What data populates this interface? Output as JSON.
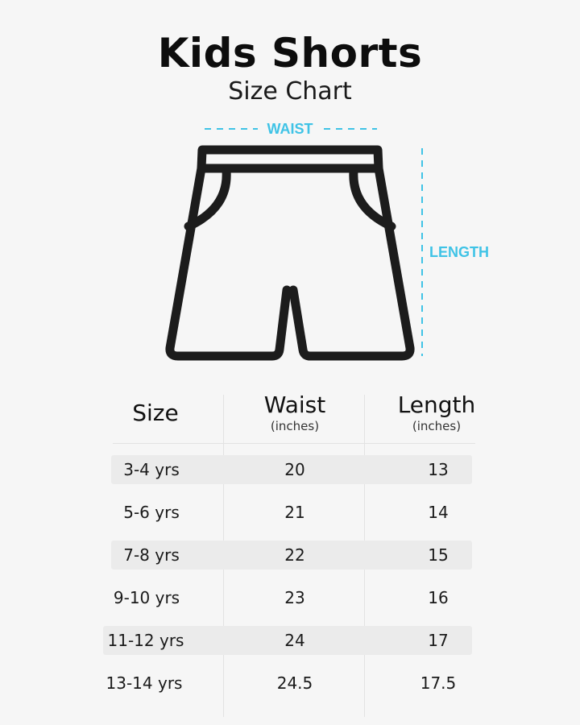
{
  "header": {
    "title": "Kids Shorts",
    "subtitle": "Size Chart"
  },
  "illustration": {
    "waist_label": "WAIST",
    "length_label": "LENGTH",
    "accent_color": "#3fc3e6",
    "outline_color": "#1c1c1c"
  },
  "table": {
    "headers": {
      "size": "Size",
      "waist": "Waist",
      "waist_unit": "(inches)",
      "length": "Length",
      "length_unit": "(inches)"
    },
    "rows": [
      {
        "size": "3-4 yrs",
        "waist": "20",
        "length": "13"
      },
      {
        "size": "5-6 yrs",
        "waist": "21",
        "length": "14"
      },
      {
        "size": "7-8 yrs",
        "waist": "22",
        "length": "15"
      },
      {
        "size": "9-10 yrs",
        "waist": "23",
        "length": "16"
      },
      {
        "size": "11-12 yrs",
        "waist": "24",
        "length": "17"
      },
      {
        "size": "13-14 yrs",
        "waist": "24.5",
        "length": "17.5"
      }
    ]
  }
}
